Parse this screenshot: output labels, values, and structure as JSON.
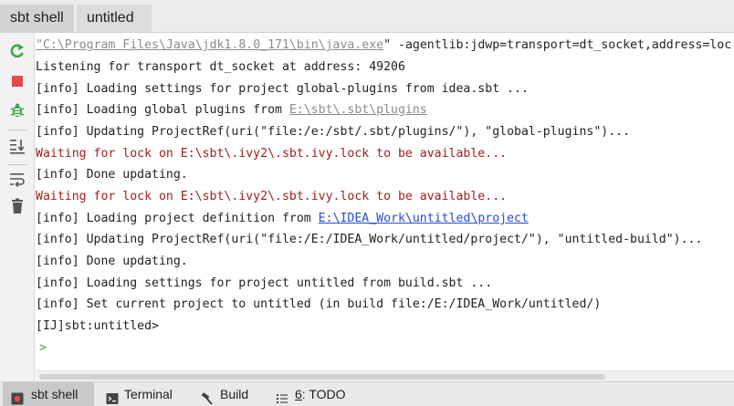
{
  "tabs": [
    {
      "label": "sbt shell"
    },
    {
      "label": "untitled"
    }
  ],
  "toolbar": {
    "icons": [
      "rerun-icon",
      "stop-icon",
      "debug-icon",
      "scroll-to-end-icon",
      "soft-wrap-icon",
      "trash-icon"
    ]
  },
  "console": {
    "cmd": {
      "quote_open": "\"",
      "path": "C:\\Program Files\\Java\\jdk1.8.0_171\\bin\\java.exe",
      "quote_close": "\"",
      "rest": " -agentlib:jdwp=transport=dt_socket,address=loc"
    },
    "listening": "Listening for transport dt_socket at address: 49206",
    "info_loading_global_plugins_settings": "[info] Loading settings for project global-plugins from idea.sbt ...",
    "info_loading_global_plugins_prefix": "[info] Loading global plugins from ",
    "global_plugins_link": "E:\\sbt\\.sbt\\plugins",
    "info_updating_global": "[info] Updating ProjectRef(uri(\"file:/e:/sbt/.sbt/plugins/\"), \"global-plugins\")...",
    "waiting_lock_1": "Waiting for lock on E:\\sbt\\.ivy2\\.sbt.ivy.lock to be available...",
    "info_done_1": "[info] Done updating.",
    "waiting_lock_2": "Waiting for lock on E:\\sbt\\.ivy2\\.sbt.ivy.lock to be available...",
    "info_loading_project_def_prefix": "[info] Loading project definition from ",
    "project_def_link": "E:\\IDEA_Work\\untitled\\project",
    "info_updating_build": "[info] Updating ProjectRef(uri(\"file:/E:/IDEA_Work/untitled/project/\"), \"untitled-build\")...",
    "info_done_2": "[info] Done updating.",
    "info_loading_settings_untitled": "[info] Loading settings for project untitled from build.sbt ...",
    "info_set_current": "[info] Set current project to untitled (in build file:/E:/IDEA_Work/untitled/)",
    "prompt": "[IJ]sbt:untitled>",
    "input_caret": ">"
  },
  "bottom_bar": {
    "items": [
      {
        "label": "sbt shell"
      },
      {
        "label": "Terminal"
      },
      {
        "label": "Build"
      },
      {
        "num": "6",
        "label": ": TODO"
      }
    ]
  },
  "colors": {
    "warning": "#a01e1e",
    "link": "#2a4bd1",
    "rerun": "#3aa84a",
    "stop": "#e04a4a",
    "debug": "#3aa84a"
  }
}
